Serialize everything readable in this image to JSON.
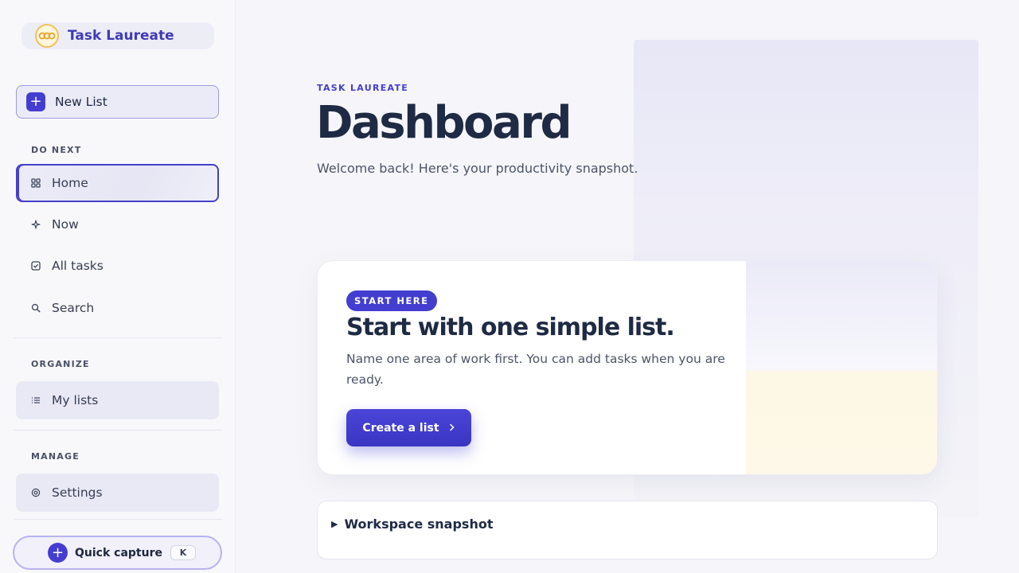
{
  "brand": {
    "name": "Task Laureate"
  },
  "sidebar": {
    "new_list_label": "New List",
    "sections": {
      "do_next": "DO NEXT",
      "organize": "ORGANIZE",
      "manage": "MANAGE"
    },
    "items": [
      {
        "label": "Home",
        "icon": "grid-icon",
        "active": true
      },
      {
        "label": "Now",
        "icon": "sparkle-icon"
      },
      {
        "label": "All tasks",
        "icon": "checkbox-icon"
      },
      {
        "label": "Search",
        "icon": "search-icon"
      },
      {
        "label": "My lists",
        "icon": "list-icon"
      },
      {
        "label": "Settings",
        "icon": "settings-icon"
      }
    ],
    "quick_capture": {
      "label": "Quick capture",
      "shortcut": "K"
    }
  },
  "main": {
    "eyebrow": "TASK LAUREATE",
    "title": "Dashboard",
    "subtitle": "Welcome back! Here's your productivity snapshot.",
    "card": {
      "badge": "START HERE",
      "title": "Start with one simple list.",
      "description": "Name one area of work first. You can add tasks when you are ready.",
      "cta_label": "Create a list"
    },
    "snapshot": {
      "label": "Workspace snapshot"
    }
  },
  "colors": {
    "accent": "#433ed0",
    "text_dark": "#1f2a44",
    "text_muted": "#4c5468",
    "sidebar_bg": "#f8f8fb"
  }
}
